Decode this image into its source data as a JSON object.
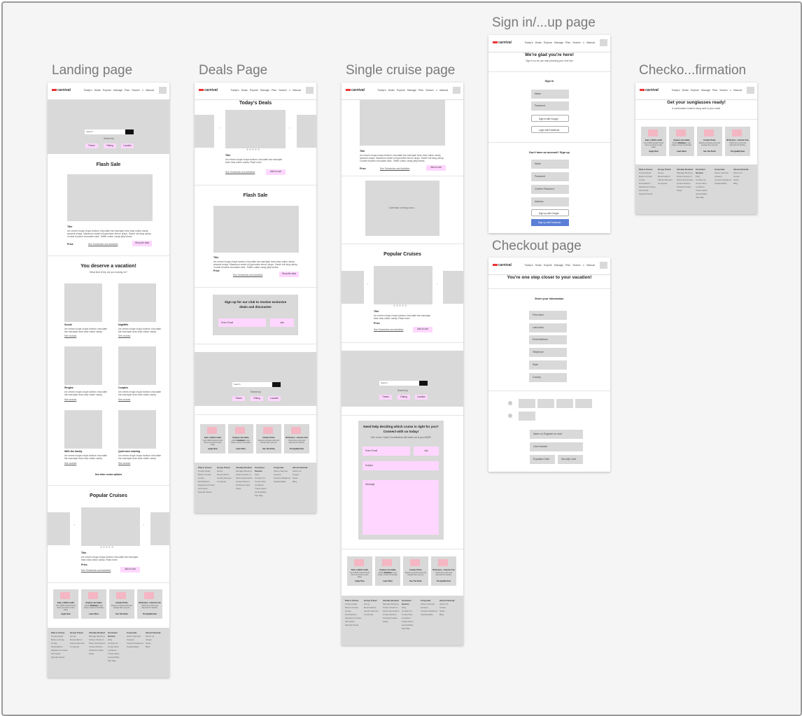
{
  "frames": {
    "landing": {
      "title": "Landing page"
    },
    "deals": {
      "title": "Deals Page"
    },
    "single": {
      "title": "Single cruise page"
    },
    "signin": {
      "title": "Sign in/...up page"
    },
    "checkoutconf": {
      "title": "Checko...firmation"
    },
    "checkout": {
      "title": "Checkout page"
    }
  },
  "nav": {
    "logo": "carnival",
    "links": "Today's Deals   Explore   Manage   Plan   Search ∨  Manual"
  },
  "hero": {
    "search_placeholder": "Search",
    "search_by": "Search by",
    "filters": [
      "Theme",
      "Rating",
      "Location"
    ]
  },
  "flash": {
    "heading": "Flash Sale",
    "title": "Title",
    "text": "Ice cream chupa chups bonbon chocolate bar marzipan bear claw cotton candy sesame snaps. Macaroon sweet roll gummies lemon drops. Sweet roll icing candy. Cookie brownie chocolate cake. Toffee cotton candy jelly beans.",
    "price": "Price",
    "sched": "See Schedules and Activities",
    "shop": "Shop the deal"
  },
  "vacation": {
    "heading": "You deserve a vacation!",
    "sub": "What kind of trip are you looking for?",
    "cards": [
      {
        "title": "Social",
        "link": "See cruises"
      },
      {
        "title": "Nightlife",
        "link": "See cruises"
      },
      {
        "title": "Singles",
        "link": "See cruises"
      },
      {
        "title": "Couples",
        "link": "See cruises"
      },
      {
        "title": "With the family",
        "link": "See cruises"
      },
      {
        "title": "Quiet and relaxing",
        "link": "See cruises"
      }
    ],
    "text": "Ice cream chupa chups bonbon chocolate bar marzipan bear claw cotton candy.",
    "other": "See other cruise options"
  },
  "popular": {
    "heading": "Popular Cruises",
    "title": "Title",
    "price": "Price",
    "sched": "See Schedules and Activities",
    "add": "Add to cart",
    "text": "Ice cream chupa chups bonbon chocolate bar marzipan bear claw cotton candy. Read more"
  },
  "deals": {
    "heading": "Today's Deals",
    "title": "Title",
    "sched": "See Schedules and Activities",
    "add": "Add to cart",
    "club": "Sign up for our club to receive exclusive deals and discounts!",
    "email": "Enter Email",
    "join": "Join"
  },
  "promos": [
    {
      "title": "Earn a $100 credit",
      "text": "Get a $100 onboard credit when you book a cruise today.",
      "cta": "Apply Now"
    },
    {
      "title": "Explore Australia Cruises",
      "text": "Explore exotic ports and unique cruises to Australia.",
      "cta": "Learn More"
    },
    {
      "title": "Insider Perks",
      "text": "Receive exclusive perks and savings when you join.",
      "cta": "See The Perks"
    },
    {
      "title": "30 Rooms + Interior Fee",
      "text": "Unlock free rooms and discounts for families.",
      "cta": "Pre-Qualify Now"
    }
  ],
  "footer": [
    {
      "head": "Plan A Cruise",
      "items": [
        "Cruise Deals",
        "Book a Cruise",
        "Cruise Destinations",
        "Weekend Cruises",
        "Gift Cards",
        "Special Needs"
      ]
    },
    {
      "head": "Group Travel",
      "items": [
        "Group Reservations",
        "Family Reunion",
        "Corporate"
      ]
    },
    {
      "head": "Already Booked",
      "items": [
        "Manage Booking",
        "Online Check-In",
        "Shore Excursions",
        "Cruise Planner",
        "Onboard Guide",
        "FAQs"
      ]
    },
    {
      "head": "Customer Service",
      "items": [
        "FAQ",
        "Contact Us",
        "Cruise Ship Locations",
        "Travel Alerts",
        "Accessibility",
        "Site Map"
      ]
    },
    {
      "head": "Corporate",
      "items": [
        "About Carnival",
        "Careers",
        "Investor Relations",
        "Sustainability"
      ]
    },
    {
      "head": "About Carnival",
      "items": [
        "About Us",
        "Career",
        "News",
        "Blog"
      ]
    }
  ],
  "single": {
    "title": "Title",
    "price": "Price",
    "sched": "See Schedules and Activities",
    "add": "Add to cart",
    "calendar": "Calendar coming soon...",
    "help_heading": "Need help deciding which cruise is right for you? Connect with us today!",
    "help_sub": "One of our Cruise Coordinators will reach out to you ASAP!",
    "email": "Enter Email",
    "join": "Join",
    "subject": "Subject",
    "message": "Message"
  },
  "signin": {
    "heading": "We're glad you're here!",
    "sub": "Sign in so we can start planning your next trip!",
    "signin_label": "Sign In",
    "name": "Name",
    "password": "Password",
    "google": "Sign in with Google",
    "facebook": "Login with Facebook",
    "signup_label": "Don't have an account? Sign up",
    "s_name": "Name",
    "s_password": "Password",
    "s_confirm": "Confirm Password",
    "s_address": "Address",
    "s_google": "Sign up with Google",
    "s_facebook": "Sign up with Facebook"
  },
  "checkoutconf": {
    "heading": "Get your sunglasses ready!",
    "sub": "A confirmation email is being sent to your email."
  },
  "checkout": {
    "heading": "You're one step closer to your vacation!",
    "info": "Enter your information",
    "fields": [
      "First name",
      "Last name",
      "Email Address",
      "Telephone",
      "State",
      "Country"
    ],
    "pay_fields": [
      "Name on Engraver on card",
      "Card Number",
      "Expiration Date",
      "Security Code"
    ]
  },
  "colors": {
    "accent": "#ffd6ff",
    "placeholder": "#d9d9d9",
    "promo": "#f4b6c2",
    "facebook": "#5b7fd6"
  }
}
